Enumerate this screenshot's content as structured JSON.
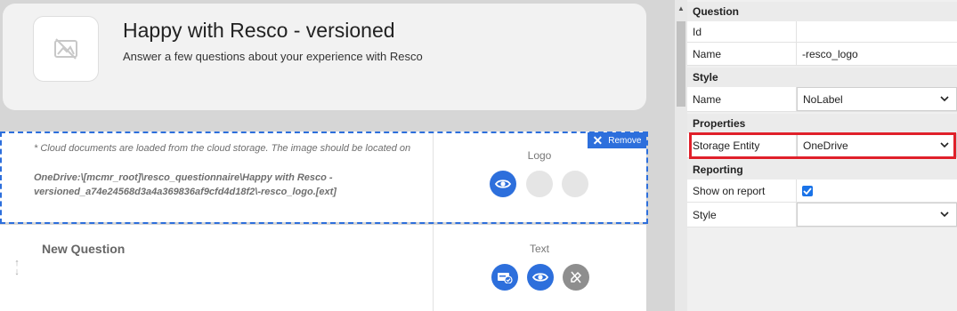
{
  "questionnaire": {
    "title": "Happy with Resco - versioned",
    "description": "Answer a few questions about your experience with Resco"
  },
  "logo_row": {
    "note": "* Cloud documents are loaded from the cloud storage. The image should be located on",
    "path": "OneDrive:\\[mcmr_root]\\resco_questionnaire\\Happy with Resco - versioned_a74e24568d3a4a369836af9cfd4d18f2\\-resco_logo.[ext]",
    "field_type": "Logo",
    "remove_label": "Remove"
  },
  "question_row": {
    "label": "New Question",
    "field_type": "Text",
    "drag_up": "↑",
    "drag_down": "↓"
  },
  "properties": {
    "sections": {
      "question": "Question",
      "style": "Style",
      "properties": "Properties",
      "reporting": "Reporting"
    },
    "rows": {
      "id": {
        "label": "Id",
        "value": ""
      },
      "name": {
        "label": "Name",
        "value": "-resco_logo"
      },
      "style_name": {
        "label": "Name",
        "value": "NoLabel"
      },
      "storage_entity": {
        "label": "Storage Entity",
        "value": "OneDrive"
      },
      "show_on_report": {
        "label": "Show on report",
        "checked": true
      },
      "report_style": {
        "label": "Style",
        "value": ""
      }
    }
  },
  "colors": {
    "accent": "#2d6fdc",
    "highlight": "#e0202a"
  }
}
